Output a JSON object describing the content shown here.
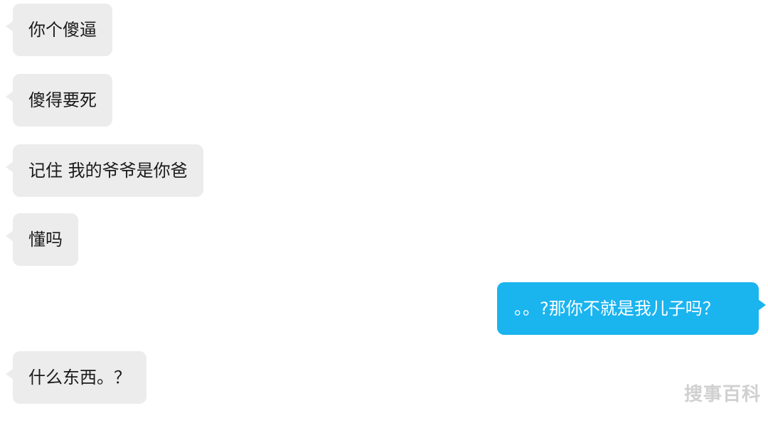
{
  "messages": [
    {
      "side": "left",
      "text": "你个傻逼"
    },
    {
      "side": "left",
      "text": "傻得要死"
    },
    {
      "side": "left",
      "text": "记住 我的爷爷是你爸"
    },
    {
      "side": "left",
      "text": "懂吗"
    },
    {
      "side": "right",
      "text": "。。?那你不就是我儿子吗？"
    },
    {
      "side": "left",
      "text": "什么东西。？"
    }
  ],
  "watermark": "搜事百科",
  "colors": {
    "incoming_bubble": "#ececec",
    "outgoing_bubble": "#1ab4ef",
    "background": "#ffffff"
  }
}
